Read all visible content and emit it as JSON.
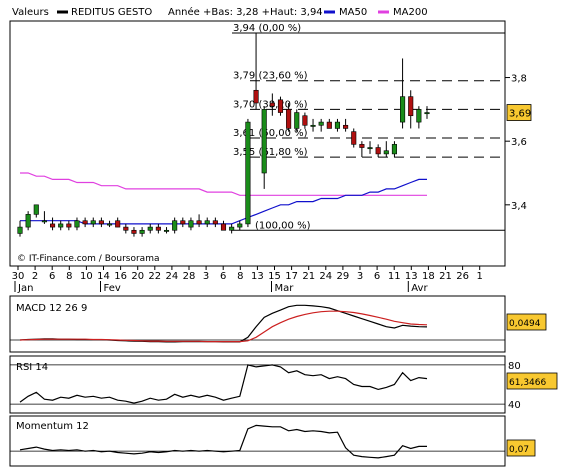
{
  "header": {
    "valeurs_label": "Valeurs",
    "series_name": "REDITUS GESTO",
    "range_text": "Année +Bas: 3,28 +Haut: 3,94",
    "ma50_label": "MA50",
    "ma200_label": "MA200"
  },
  "colors": {
    "ma50": "#1010cc",
    "ma200": "#e040e0",
    "up": "#1a8c1a",
    "down": "#b01010",
    "last_box": "#f8c830"
  },
  "credit": "© IT-Finance.com / Boursorama",
  "x_ticks": [
    "30",
    "2",
    "6",
    "8",
    "10",
    "14",
    "16",
    "20",
    "22",
    "24",
    "28",
    "3",
    "6",
    "8",
    "13",
    "15",
    "17",
    "21",
    "24",
    "29",
    "3",
    "6",
    "11",
    "13",
    "18",
    "21",
    "26",
    "1"
  ],
  "month_labels": [
    {
      "label": "Jan",
      "at": 0
    },
    {
      "label": "Fev",
      "at": 5
    },
    {
      "label": "Mar",
      "at": 15
    },
    {
      "label": "Avr",
      "at": 23
    }
  ],
  "chart_data": [
    {
      "type": "candlestick",
      "title": "REDITUS GESTO",
      "ylim": [
        3.28,
        3.94
      ],
      "y_ticks": [
        3.4,
        3.6,
        3.8
      ],
      "y_tick_labels": [
        "3,4",
        "3,6",
        "3,8"
      ],
      "last_value": 3.69,
      "last_value_label": "3,69",
      "fib_levels": [
        {
          "value": 3.94,
          "label": "3,94 (0,00 %)"
        },
        {
          "value": 3.79,
          "label": "3,79 (23,60 %)"
        },
        {
          "value": 3.7,
          "label": "3,70 (38,20 %)"
        },
        {
          "value": 3.61,
          "label": "3,61 (50,00 %)"
        },
        {
          "value": 3.55,
          "label": "3,55 (61,80 %)"
        },
        {
          "value": 3.32,
          "label": "(100,00 %)"
        }
      ],
      "candles": [
        {
          "o": 3.31,
          "h": 3.35,
          "l": 3.3,
          "c": 3.33
        },
        {
          "o": 3.33,
          "h": 3.38,
          "l": 3.32,
          "c": 3.37
        },
        {
          "o": 3.37,
          "h": 3.4,
          "l": 3.36,
          "c": 3.4
        },
        {
          "o": 3.35,
          "h": 3.38,
          "l": 3.34,
          "c": 3.35
        },
        {
          "o": 3.34,
          "h": 3.36,
          "l": 3.32,
          "c": 3.33
        },
        {
          "o": 3.33,
          "h": 3.35,
          "l": 3.32,
          "c": 3.34
        },
        {
          "o": 3.34,
          "h": 3.35,
          "l": 3.32,
          "c": 3.33
        },
        {
          "o": 3.33,
          "h": 3.36,
          "l": 3.32,
          "c": 3.35
        },
        {
          "o": 3.35,
          "h": 3.36,
          "l": 3.33,
          "c": 3.34
        },
        {
          "o": 3.34,
          "h": 3.36,
          "l": 3.33,
          "c": 3.35
        },
        {
          "o": 3.35,
          "h": 3.36,
          "l": 3.33,
          "c": 3.34
        },
        {
          "o": 3.34,
          "h": 3.35,
          "l": 3.33,
          "c": 3.34
        },
        {
          "o": 3.35,
          "h": 3.36,
          "l": 3.33,
          "c": 3.33
        },
        {
          "o": 3.33,
          "h": 3.34,
          "l": 3.31,
          "c": 3.32
        },
        {
          "o": 3.32,
          "h": 3.33,
          "l": 3.3,
          "c": 3.31
        },
        {
          "o": 3.31,
          "h": 3.33,
          "l": 3.3,
          "c": 3.32
        },
        {
          "o": 3.32,
          "h": 3.34,
          "l": 3.31,
          "c": 3.33
        },
        {
          "o": 3.33,
          "h": 3.34,
          "l": 3.31,
          "c": 3.32
        },
        {
          "o": 3.32,
          "h": 3.33,
          "l": 3.31,
          "c": 3.32
        },
        {
          "o": 3.32,
          "h": 3.36,
          "l": 3.31,
          "c": 3.35
        },
        {
          "o": 3.35,
          "h": 3.36,
          "l": 3.33,
          "c": 3.34
        },
        {
          "o": 3.33,
          "h": 3.36,
          "l": 3.32,
          "c": 3.35
        },
        {
          "o": 3.35,
          "h": 3.37,
          "l": 3.33,
          "c": 3.34
        },
        {
          "o": 3.34,
          "h": 3.36,
          "l": 3.33,
          "c": 3.35
        },
        {
          "o": 3.35,
          "h": 3.36,
          "l": 3.33,
          "c": 3.34
        },
        {
          "o": 3.34,
          "h": 3.35,
          "l": 3.32,
          "c": 3.32
        },
        {
          "o": 3.32,
          "h": 3.34,
          "l": 3.31,
          "c": 3.33
        },
        {
          "o": 3.33,
          "h": 3.35,
          "l": 3.32,
          "c": 3.34
        },
        {
          "o": 3.34,
          "h": 3.67,
          "l": 3.33,
          "c": 3.66
        },
        {
          "o": 3.76,
          "h": 3.94,
          "l": 3.7,
          "c": 3.72
        },
        {
          "o": 3.5,
          "h": 3.71,
          "l": 3.45,
          "c": 3.7
        },
        {
          "o": 3.72,
          "h": 3.75,
          "l": 3.68,
          "c": 3.71
        },
        {
          "o": 3.73,
          "h": 3.74,
          "l": 3.68,
          "c": 3.69
        },
        {
          "o": 3.7,
          "h": 3.72,
          "l": 3.63,
          "c": 3.64
        },
        {
          "o": 3.64,
          "h": 3.7,
          "l": 3.63,
          "c": 3.69
        },
        {
          "o": 3.68,
          "h": 3.69,
          "l": 3.64,
          "c": 3.65
        },
        {
          "o": 3.65,
          "h": 3.67,
          "l": 3.63,
          "c": 3.65
        },
        {
          "o": 3.65,
          "h": 3.67,
          "l": 3.63,
          "c": 3.66
        },
        {
          "o": 3.66,
          "h": 3.67,
          "l": 3.64,
          "c": 3.64
        },
        {
          "o": 3.64,
          "h": 3.67,
          "l": 3.63,
          "c": 3.66
        },
        {
          "o": 3.65,
          "h": 3.67,
          "l": 3.63,
          "c": 3.64
        },
        {
          "o": 3.63,
          "h": 3.64,
          "l": 3.58,
          "c": 3.59
        },
        {
          "o": 3.59,
          "h": 3.6,
          "l": 3.55,
          "c": 3.58
        },
        {
          "o": 3.58,
          "h": 3.6,
          "l": 3.56,
          "c": 3.58
        },
        {
          "o": 3.58,
          "h": 3.59,
          "l": 3.55,
          "c": 3.56
        },
        {
          "o": 3.56,
          "h": 3.6,
          "l": 3.55,
          "c": 3.57
        },
        {
          "o": 3.56,
          "h": 3.6,
          "l": 3.55,
          "c": 3.59
        },
        {
          "o": 3.66,
          "h": 3.86,
          "l": 3.64,
          "c": 3.74
        },
        {
          "o": 3.74,
          "h": 3.76,
          "l": 3.64,
          "c": 3.68
        },
        {
          "o": 3.66,
          "h": 3.71,
          "l": 3.64,
          "c": 3.7
        },
        {
          "o": 3.69,
          "h": 3.71,
          "l": 3.67,
          "c": 3.69
        }
      ],
      "ma50": [
        3.35,
        3.35,
        3.35,
        3.35,
        3.35,
        3.35,
        3.35,
        3.35,
        3.34,
        3.34,
        3.34,
        3.34,
        3.34,
        3.34,
        3.34,
        3.34,
        3.34,
        3.34,
        3.34,
        3.34,
        3.34,
        3.34,
        3.34,
        3.34,
        3.34,
        3.34,
        3.34,
        3.35,
        3.36,
        3.37,
        3.38,
        3.39,
        3.4,
        3.4,
        3.41,
        3.41,
        3.41,
        3.42,
        3.42,
        3.42,
        3.43,
        3.43,
        3.43,
        3.44,
        3.44,
        3.45,
        3.45,
        3.46,
        3.47,
        3.48,
        3.48
      ],
      "ma200": [
        3.5,
        3.5,
        3.49,
        3.49,
        3.48,
        3.48,
        3.48,
        3.47,
        3.47,
        3.47,
        3.46,
        3.46,
        3.46,
        3.45,
        3.45,
        3.45,
        3.45,
        3.45,
        3.45,
        3.45,
        3.45,
        3.45,
        3.45,
        3.44,
        3.44,
        3.44,
        3.44,
        3.43,
        3.43,
        3.43,
        3.43,
        3.43,
        3.43,
        3.43,
        3.43,
        3.43,
        3.43,
        3.43,
        3.43,
        3.43,
        3.43,
        3.43,
        3.43,
        3.43,
        3.43,
        3.43,
        3.43,
        3.43,
        3.43,
        3.43,
        3.43
      ]
    },
    {
      "type": "line",
      "title": "MACD 12 26 9",
      "last_value_label": "0,0494",
      "ylim": [
        -0.03,
        0.15
      ],
      "series": [
        {
          "values": [
            0.0,
            0.002,
            0.003,
            0.004,
            0.004,
            0.003,
            0.003,
            0.002,
            0.002,
            0.001,
            0.001,
            0.0,
            -0.002,
            -0.003,
            -0.004,
            -0.005,
            -0.006,
            -0.006,
            -0.007,
            -0.007,
            -0.006,
            -0.006,
            -0.006,
            -0.006,
            -0.006,
            -0.007,
            -0.007,
            -0.007,
            0.01,
            0.05,
            0.085,
            0.1,
            0.112,
            0.125,
            0.13,
            0.13,
            0.128,
            0.125,
            0.12,
            0.11,
            0.1,
            0.09,
            0.08,
            0.07,
            0.06,
            0.05,
            0.045,
            0.055,
            0.052,
            0.05,
            0.049
          ]
        },
        {
          "values": [
            0.0,
            0.001,
            0.002,
            0.003,
            0.003,
            0.003,
            0.003,
            0.003,
            0.003,
            0.002,
            0.002,
            0.001,
            0.0,
            -0.001,
            -0.002,
            -0.003,
            -0.004,
            -0.004,
            -0.005,
            -0.005,
            -0.005,
            -0.005,
            -0.005,
            -0.006,
            -0.006,
            -0.006,
            -0.006,
            -0.006,
            -0.003,
            0.01,
            0.03,
            0.05,
            0.065,
            0.078,
            0.088,
            0.096,
            0.102,
            0.106,
            0.108,
            0.108,
            0.106,
            0.103,
            0.098,
            0.092,
            0.085,
            0.078,
            0.07,
            0.065,
            0.06,
            0.058,
            0.057
          ]
        }
      ]
    },
    {
      "type": "line",
      "title": "RSI 14",
      "y_ticks": [
        40,
        80
      ],
      "ylim": [
        35,
        85
      ],
      "last_value_label": "61,3466",
      "series": [
        {
          "values": [
            42,
            48,
            52,
            45,
            44,
            47,
            46,
            49,
            47,
            48,
            46,
            47,
            44,
            43,
            41,
            43,
            46,
            44,
            45,
            50,
            47,
            49,
            47,
            49,
            47,
            44,
            46,
            48,
            80,
            78,
            79,
            80,
            78,
            72,
            74,
            70,
            69,
            70,
            66,
            68,
            66,
            60,
            58,
            58,
            55,
            57,
            60,
            72,
            64,
            67,
            66
          ]
        }
      ]
    },
    {
      "type": "line",
      "title": "Momentum 12",
      "last_value_label": "0,07",
      "ylim": [
        -0.16,
        0.46
      ],
      "series": [
        {
          "values": [
            0.02,
            0.04,
            0.06,
            0.03,
            0.01,
            0.02,
            0.01,
            0.02,
            0.0,
            0.01,
            -0.01,
            0.0,
            -0.02,
            -0.03,
            -0.04,
            -0.03,
            -0.01,
            -0.02,
            -0.01,
            0.01,
            0.0,
            0.01,
            0.0,
            0.01,
            0.0,
            -0.01,
            0.0,
            0.01,
            0.33,
            0.38,
            0.37,
            0.36,
            0.36,
            0.3,
            0.32,
            0.29,
            0.3,
            0.29,
            0.27,
            0.28,
            0.05,
            -0.06,
            -0.08,
            -0.09,
            -0.1,
            -0.08,
            -0.06,
            0.08,
            0.04,
            0.07,
            0.07
          ]
        }
      ]
    }
  ]
}
